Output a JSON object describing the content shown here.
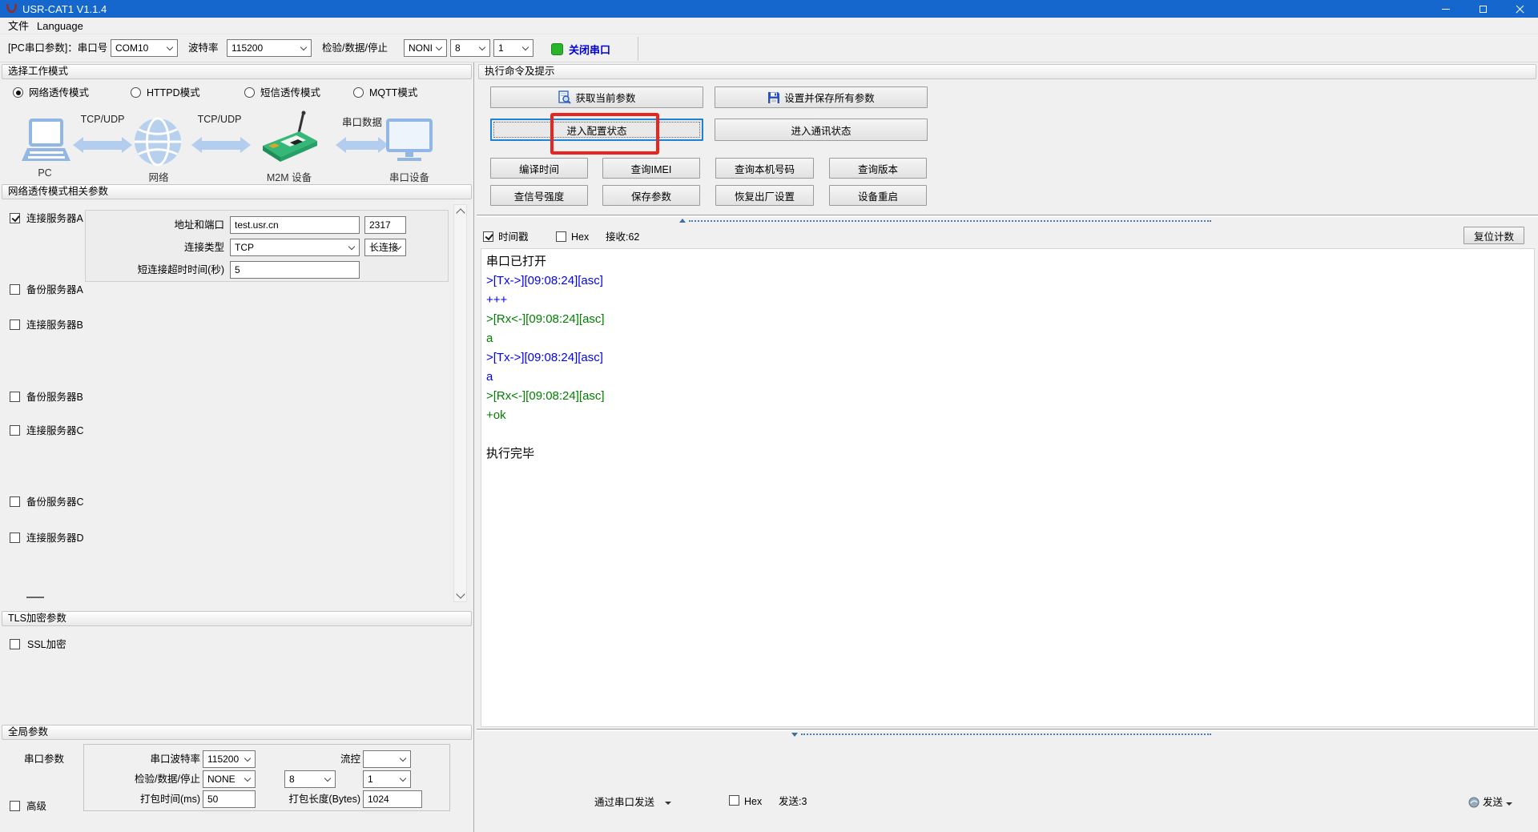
{
  "colors": {
    "titlebar": "#1567cd",
    "close_port_text": "#0000d8",
    "led_green": "#28b52c",
    "annotation": "#e8251f"
  },
  "window": {
    "title": "USR-CAT1 V1.1.4"
  },
  "menu": {
    "file": "文件",
    "language": "Language"
  },
  "toolbar": {
    "pc_serial_label": "[PC串口参数]：串口号",
    "com_port": "COM10",
    "baud_label": "波特率",
    "baud": "115200",
    "parity_label": "检验/数据/停止",
    "parity": "NONI",
    "data_bits": "8",
    "stop_bits": "1",
    "close_port_label": "关闭串口"
  },
  "work_mode": {
    "header": "选择工作模式",
    "options": [
      {
        "label": "网络透传模式",
        "selected": true
      },
      {
        "label": "HTTPD模式",
        "selected": false
      },
      {
        "label": "短信透传模式",
        "selected": false
      },
      {
        "label": "MQTT模式",
        "selected": false
      }
    ]
  },
  "diagram": {
    "links": [
      "TCP/UDP",
      "TCP/UDP",
      "串口数据"
    ],
    "nodes": [
      "PC",
      "网络",
      "M2M 设备",
      "串口设备"
    ]
  },
  "net": {
    "header": "网络透传模式相关参数",
    "server_a": {
      "label": "连接服务器A",
      "checked": true
    },
    "addr_label": "地址和端口",
    "addr": "test.usr.cn",
    "port": "2317",
    "type_label": "连接类型",
    "type": "TCP",
    "mode": "长连接",
    "timeout_label": "短连接超时时间(秒)",
    "timeout": "5",
    "servers": [
      {
        "label": "备份服务器A",
        "checked": false
      },
      {
        "label": "连接服务器B",
        "checked": false
      },
      {
        "label": "备份服务器B",
        "checked": false
      },
      {
        "label": "连接服务器C",
        "checked": false
      },
      {
        "label": "备份服务器C",
        "checked": false
      },
      {
        "label": "连接服务器D",
        "checked": false
      }
    ]
  },
  "tls": {
    "header": "TLS加密参数",
    "ssl": {
      "label": "SSL加密",
      "checked": false
    }
  },
  "global": {
    "header": "全局参数",
    "group_label": "串口参数",
    "baud_label": "串口波特率",
    "baud": "115200",
    "flow_label": "流控",
    "flow": "",
    "parity_label": "检验/数据/停止",
    "parity": "NONE",
    "data_bits": "8",
    "stop_bits": "1",
    "pack_time_label": "打包时间(ms)",
    "pack_time": "50",
    "pack_len_label": "打包长度(Bytes)",
    "pack_len": "1024",
    "advanced": {
      "label": "高级",
      "checked": false
    }
  },
  "commands": {
    "header": "执行命令及提示",
    "get_params": "获取当前参数",
    "set_save_params": "设置并保存所有参数",
    "enter_config": "进入配置状态",
    "enter_comm": "进入通讯状态",
    "grid": [
      "编译时间",
      "查询IMEI",
      "查询本机号码",
      "查询版本",
      "查信号强度",
      "保存参数",
      "恢复出厂设置",
      "设备重启"
    ]
  },
  "log": {
    "timestamp": {
      "label": "时间戳",
      "checked": true
    },
    "hex": {
      "label": "Hex",
      "checked": false
    },
    "received": "接收:62",
    "reset_count": "复位计数",
    "lines": [
      {
        "text": "串口已打开",
        "color": "#000000"
      },
      {
        "text": ">[Tx->][09:08:24][asc]",
        "color": "#0000ff"
      },
      {
        "text": "+++",
        "color": "#0000ff"
      },
      {
        "text": ">[Rx<-][09:08:24][asc]",
        "color": "#008000"
      },
      {
        "text": "a",
        "color": "#008000"
      },
      {
        "text": ">[Tx->][09:08:24][asc]",
        "color": "#0000ff"
      },
      {
        "text": "a",
        "color": "#0000ff"
      },
      {
        "text": ">[Rx<-][09:08:24][asc]",
        "color": "#008000"
      },
      {
        "text": "+ok",
        "color": "#008000"
      },
      {
        "text": "",
        "color": "#000000"
      },
      {
        "text": "执行完毕",
        "color": "#000000"
      }
    ]
  },
  "send": {
    "via_label": "通过串口发送",
    "hex": {
      "label": "Hex",
      "checked": false
    },
    "sent": "发送:3",
    "button_label": "发送"
  }
}
